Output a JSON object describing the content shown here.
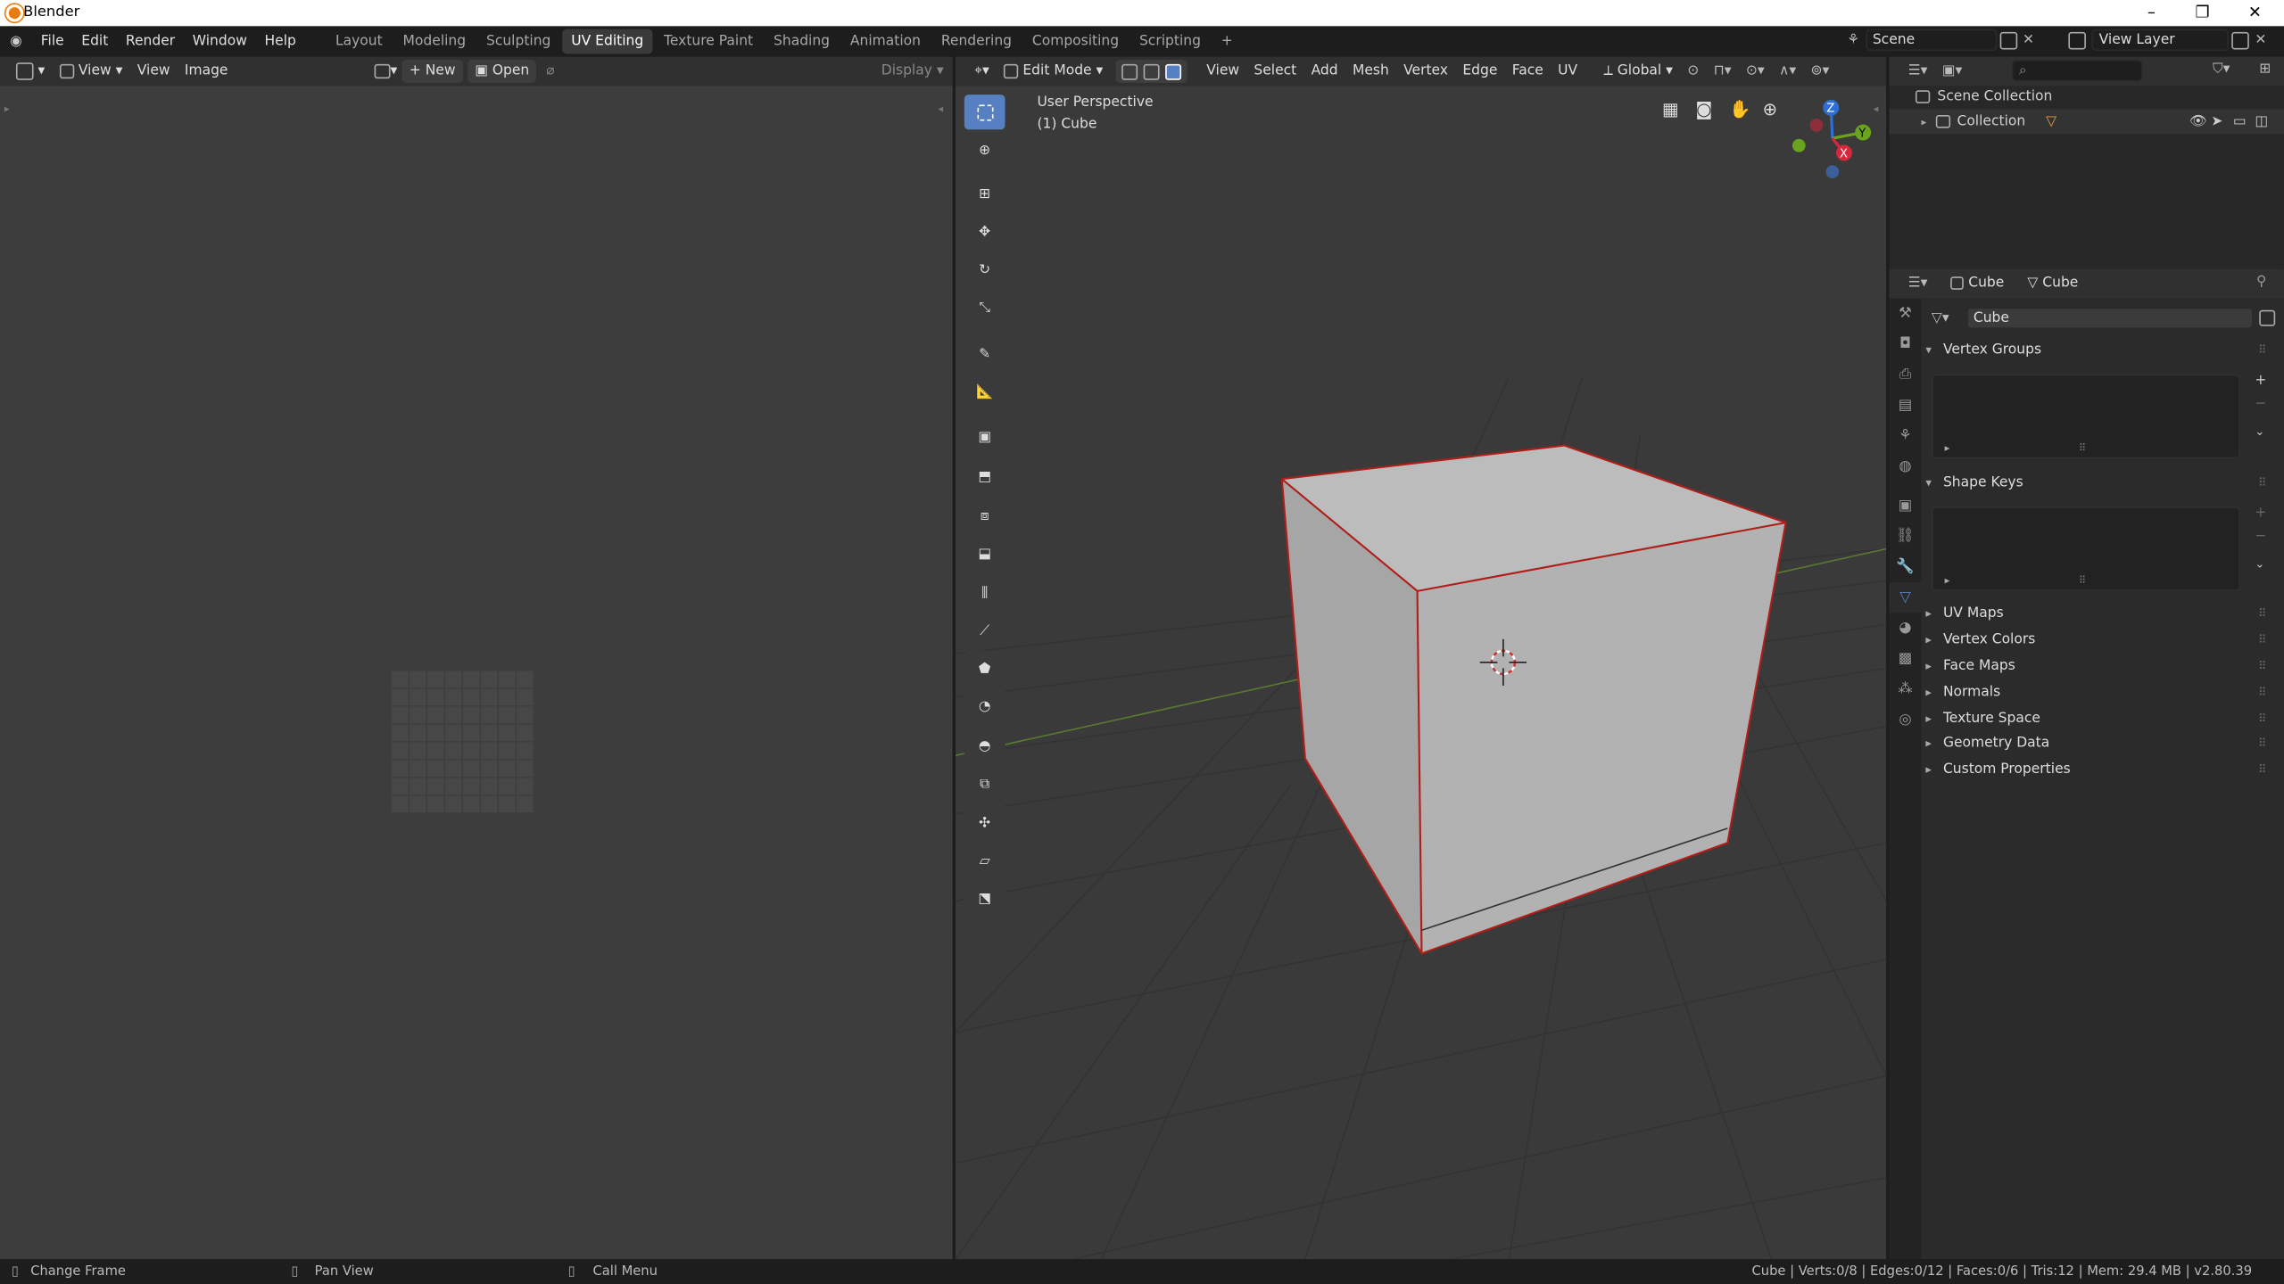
{
  "window": {
    "title": "Blender",
    "controls": [
      "–",
      "❐",
      "✕"
    ]
  },
  "menubar": {
    "items": [
      "File",
      "Edit",
      "Render",
      "Window",
      "Help"
    ]
  },
  "workspaces": {
    "tabs": [
      "Layout",
      "Modeling",
      "Sculpting",
      "UV Editing",
      "Texture Paint",
      "Shading",
      "Animation",
      "Rendering",
      "Compositing",
      "Scripting"
    ],
    "active": "UV Editing",
    "add": "+"
  },
  "scene": {
    "name": "Scene",
    "view_layer": "View Layer"
  },
  "uv_editor": {
    "header": {
      "view_menu": "View",
      "menus": [
        "View",
        "Image"
      ],
      "new_label": "New",
      "open_label": "Open",
      "display_label": "Display"
    }
  },
  "viewport": {
    "header": {
      "mode": "Edit Mode",
      "menus": [
        "View",
        "Select",
        "Add",
        "Mesh",
        "Vertex",
        "Edge",
        "Face",
        "UV"
      ],
      "orientation": "Global"
    },
    "overlay_text": {
      "perspective": "User Perspective",
      "object": "(1) Cube"
    },
    "gizmo": {
      "x": "X",
      "y": "Y",
      "z": "Z"
    },
    "tools": [
      "select-box",
      "cursor",
      "move-all",
      "move",
      "rotate",
      "scale",
      "annotate",
      "measure",
      "add-cube",
      "extrude",
      "inset",
      "bevel",
      "loop-cut",
      "knife",
      "poly-build",
      "spin",
      "smooth",
      "edge-slide",
      "shrink-fatten",
      "shear",
      "rip"
    ]
  },
  "outliner": {
    "search_placeholder": "",
    "root": "Scene Collection",
    "collection": "Collection"
  },
  "properties": {
    "breadcrumb": {
      "object": "Cube",
      "data": "Cube"
    },
    "data_name": "Cube",
    "panels": {
      "vertex_groups": "Vertex Groups",
      "shape_keys": "Shape Keys",
      "collapsed": [
        "UV Maps",
        "Vertex Colors",
        "Face Maps",
        "Normals",
        "Texture Space",
        "Geometry Data",
        "Custom Properties"
      ]
    }
  },
  "statusbar": {
    "left": [
      "Change Frame",
      "Pan View",
      "Call Menu"
    ],
    "stats": "Cube | Verts:0/8 | Edges:0/12 | Faces:0/6 | Tris:12 | Mem: 29.4 MB | v2.80.39"
  },
  "colors": {
    "accent": "#5680c2",
    "selection_edge": "#c0302a",
    "active_tab_bg": "#3a3a3a"
  }
}
